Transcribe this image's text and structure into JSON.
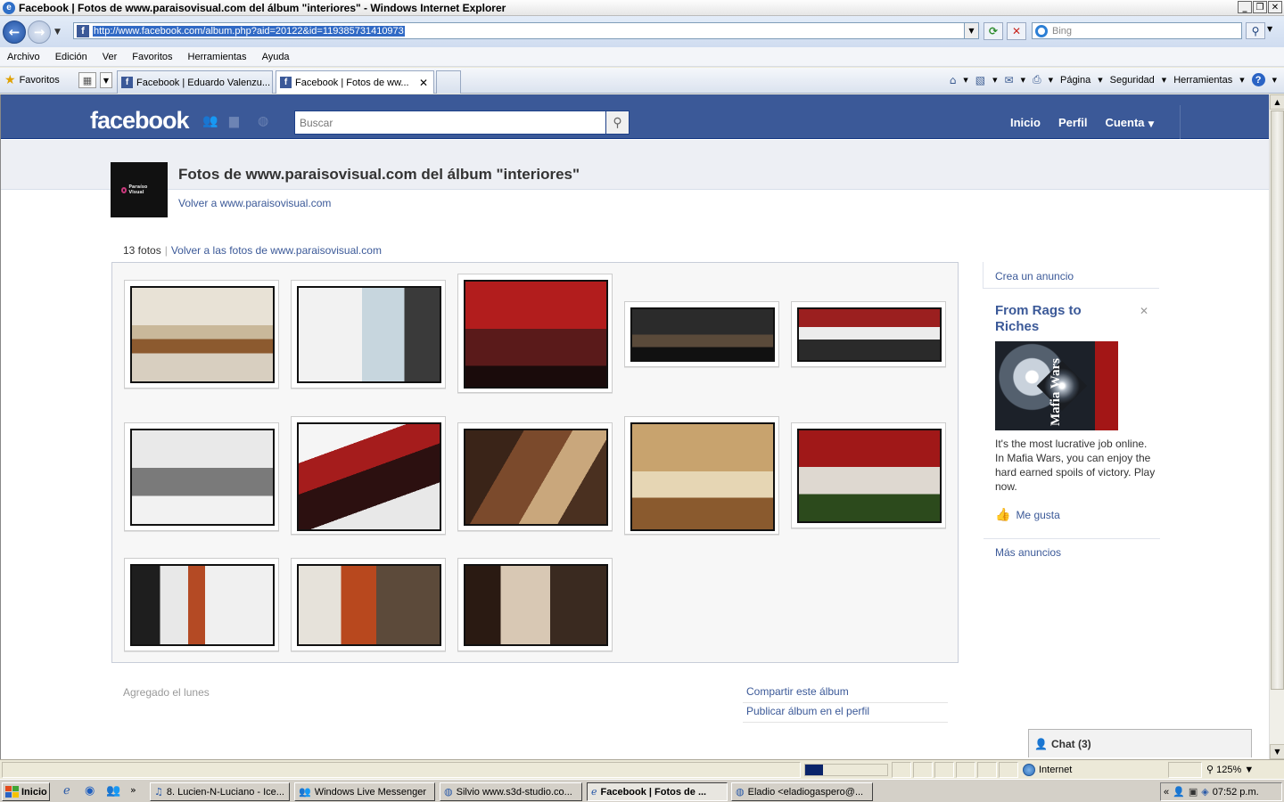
{
  "window": {
    "title": "Facebook | Fotos de www.paraisovisual.com del álbum \"interiores\" - Windows Internet Explorer",
    "buttons": [
      "_",
      "❐",
      "✕"
    ]
  },
  "addressbar": {
    "url": "http://www.facebook.com/album.php?aid=20122&id=119385731410973",
    "search_placeholder": "Bing"
  },
  "menubar": [
    "Archivo",
    "Edición",
    "Ver",
    "Favoritos",
    "Herramientas",
    "Ayuda"
  ],
  "favbar": {
    "favorites_label": "Favoritos",
    "tabs": [
      {
        "label": "Facebook | Eduardo Valenzu..."
      },
      {
        "label": "Facebook | Fotos de ww...",
        "active": true
      }
    ],
    "commands": [
      "Página",
      "Seguridad",
      "Herramientas"
    ]
  },
  "facebook": {
    "logo": "facebook",
    "search_placeholder": "Buscar",
    "nav": [
      "Inicio",
      "Perfil",
      "Cuenta"
    ],
    "brand_color": "#3b5998"
  },
  "album": {
    "page_logo_text": "Paraíso Visual",
    "title": "Fotos de www.paraisovisual.com del álbum \"interiores\"",
    "back_link": "Volver a www.paraisovisual.com",
    "photo_count": "13 fotos",
    "back_photos_link": "Volver a las fotos de www.paraisovisual.com",
    "added": "Agregado el lunes",
    "share": "Compartir este álbum",
    "publish": "Publicar álbum en el perfil"
  },
  "ads": {
    "create": "Crea un anuncio",
    "title": "From Rags to Riches",
    "image_label": "Mafia Wars",
    "body": "It's the most lucrative job online. In Mafia Wars, you can enjoy the hard earned spoils of victory. Play now.",
    "like": "Me gusta",
    "more": "Más anuncios"
  },
  "chat": {
    "label": "Chat (3)"
  },
  "statusbar": {
    "zone": "Internet",
    "zoom": "125%"
  },
  "taskbar": {
    "start": "Inicio",
    "tasks": [
      "8. Lucien-N-Luciano - Ice...",
      "Windows Live Messenger",
      "Silvio www.s3d-studio.co...",
      "Facebook | Fotos de ...",
      "Eladio <eladiogaspero@..."
    ],
    "clock": "07:52 p.m."
  }
}
